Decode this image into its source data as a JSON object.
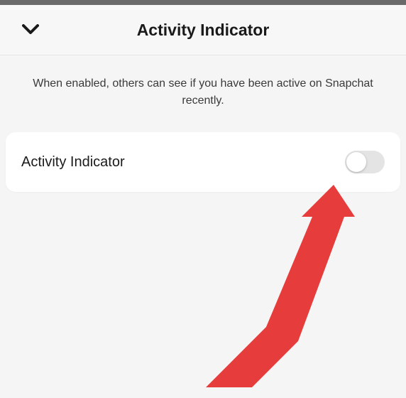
{
  "header": {
    "title": "Activity Indicator"
  },
  "description": {
    "text": "When enabled, others can see if you have been active on Snapchat recently."
  },
  "setting": {
    "label": "Activity Indicator",
    "enabled": false
  },
  "icons": {
    "chevron": "chevron-down-icon",
    "toggle": "toggle-switch"
  },
  "colors": {
    "arrow": "#e73c3c",
    "background": "#f5f5f5",
    "card": "#ffffff"
  }
}
